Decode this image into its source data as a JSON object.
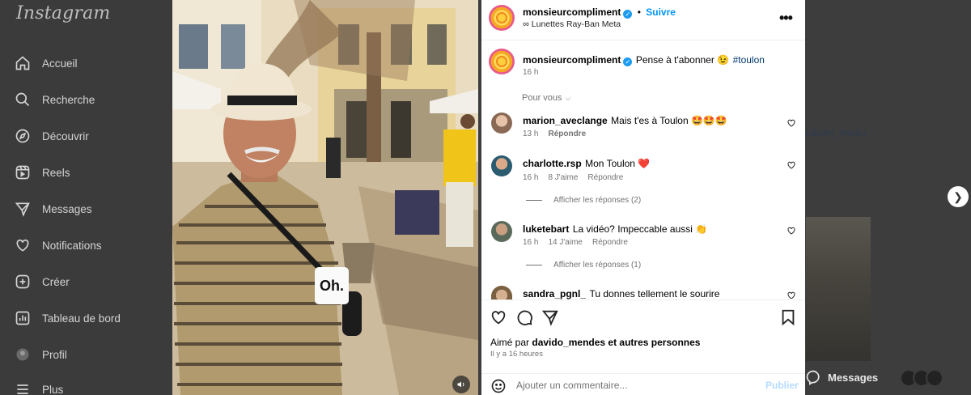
{
  "sidebar": {
    "logo": "Instagram",
    "items": [
      {
        "label": "Accueil",
        "icon": "home-icon"
      },
      {
        "label": "Recherche",
        "icon": "search-icon"
      },
      {
        "label": "Découvrir",
        "icon": "compass-icon"
      },
      {
        "label": "Reels",
        "icon": "reels-icon"
      },
      {
        "label": "Messages",
        "icon": "messages-icon"
      },
      {
        "label": "Notifications",
        "icon": "heart-icon"
      },
      {
        "label": "Créer",
        "icon": "plus-square-icon"
      },
      {
        "label": "Tableau de bord",
        "icon": "dashboard-icon"
      },
      {
        "label": "Profil",
        "icon": "profile-icon"
      },
      {
        "label": "Plus",
        "icon": "menu-icon"
      }
    ]
  },
  "background": {
    "link_fragment": "e&utm_mediu",
    "messages_label": "Messages"
  },
  "media": {
    "caption_overlay": "Oh."
  },
  "post": {
    "author": "monsieurcompliment",
    "follow_label": "Suivre",
    "separator": "•",
    "subtitle": "Lunettes Ray-Ban Meta",
    "caption": {
      "username": "monsieurcompliment",
      "text": "Pense à t'abonner 😉",
      "hashtag": "#toulon",
      "time": "16 h"
    },
    "pour_vous": "Pour vous",
    "comments": [
      {
        "username": "marion_aveclange",
        "text": "Mais t'es à Toulon 🤩🤩🤩",
        "time": "13 h",
        "likes": "",
        "reply": "Répondre",
        "view_replies": ""
      },
      {
        "username": "charlotte.rsp",
        "text": "Mon Toulon ❤️",
        "time": "16 h",
        "likes": "8 J'aime",
        "reply": "Répondre",
        "view_replies": "Afficher les réponses (2)"
      },
      {
        "username": "luketebart",
        "text": "La vidéo? Impeccable aussi 👏",
        "time": "16 h",
        "likes": "14 J'aime",
        "reply": "Répondre",
        "view_replies": "Afficher les réponses (1)"
      },
      {
        "username": "sandra_pgnl_",
        "text": "Tu donnes tellement le sourire",
        "time": "",
        "likes": "",
        "reply": "",
        "view_replies": ""
      }
    ],
    "liked_by_prefix": "Aimé par",
    "liked_by_user": "davido_mendes",
    "liked_by_suffix": "et autres personnes",
    "timestamp": "Il y a 16 heures",
    "comment_placeholder": "Ajouter un commentaire...",
    "publish_label": "Publier"
  },
  "colors": {
    "accent": "#0095f6",
    "verified": "#1d9bf0",
    "like_red": "#ed4956"
  }
}
